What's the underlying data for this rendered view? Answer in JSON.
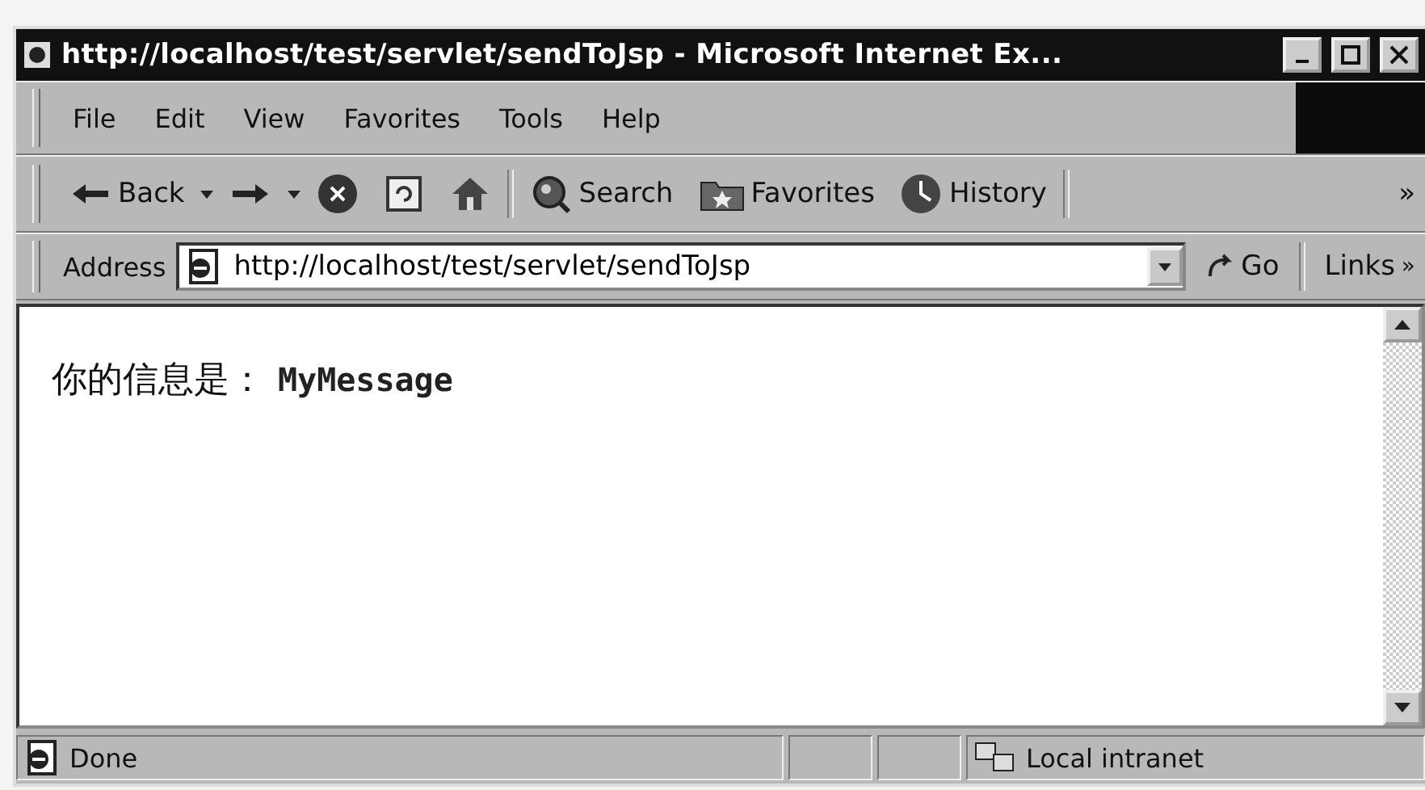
{
  "window": {
    "title": "http://localhost/test/servlet/sendToJsp - Microsoft Internet Ex..."
  },
  "menu": [
    "File",
    "Edit",
    "View",
    "Favorites",
    "Tools",
    "Help"
  ],
  "toolbar": [
    {
      "kind": "back",
      "label": "Back"
    },
    {
      "kind": "forward"
    },
    {
      "kind": "stop"
    },
    {
      "kind": "refresh"
    },
    {
      "kind": "home"
    },
    {
      "kind": "search",
      "label": "Search"
    },
    {
      "kind": "favorites",
      "label": "Favorites"
    },
    {
      "kind": "history",
      "label": "History"
    }
  ],
  "toolbar_more": "»",
  "address": {
    "label": "Address",
    "value": "http://localhost/test/servlet/sendToJsp",
    "go": "Go",
    "links": "Links",
    "links_more": "»"
  },
  "content": {
    "label": "你的信息是：",
    "value": "MyMessage"
  },
  "status_bar": {
    "text": "Done",
    "zone": "Local intranet"
  }
}
